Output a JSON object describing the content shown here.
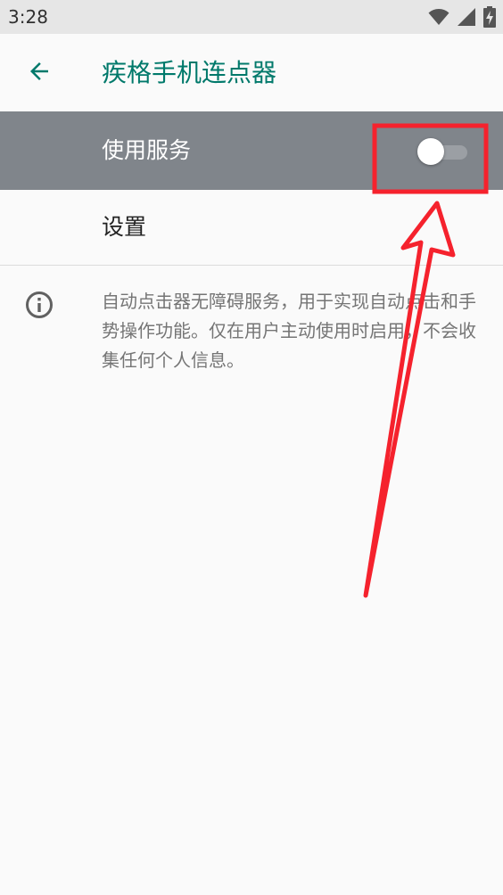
{
  "status_bar": {
    "time": "3:28",
    "icons": [
      "wifi-icon",
      "signal-icon",
      "battery-charging-icon"
    ]
  },
  "app_bar": {
    "back_icon": "arrow-back-icon",
    "title": "疾格手机连点器"
  },
  "service": {
    "label": "使用服务",
    "toggle_state": "off"
  },
  "settings": {
    "label": "设置"
  },
  "info": {
    "icon": "info-icon",
    "text": "自动点击器无障碍服务，用于实现自动点击和手势操作功能。仅在用户主动使用时启用，不会收集任何个人信息。"
  },
  "colors": {
    "accent": "#00796b",
    "service_row_bg": "#80858b",
    "annotation": "#f5222d"
  }
}
